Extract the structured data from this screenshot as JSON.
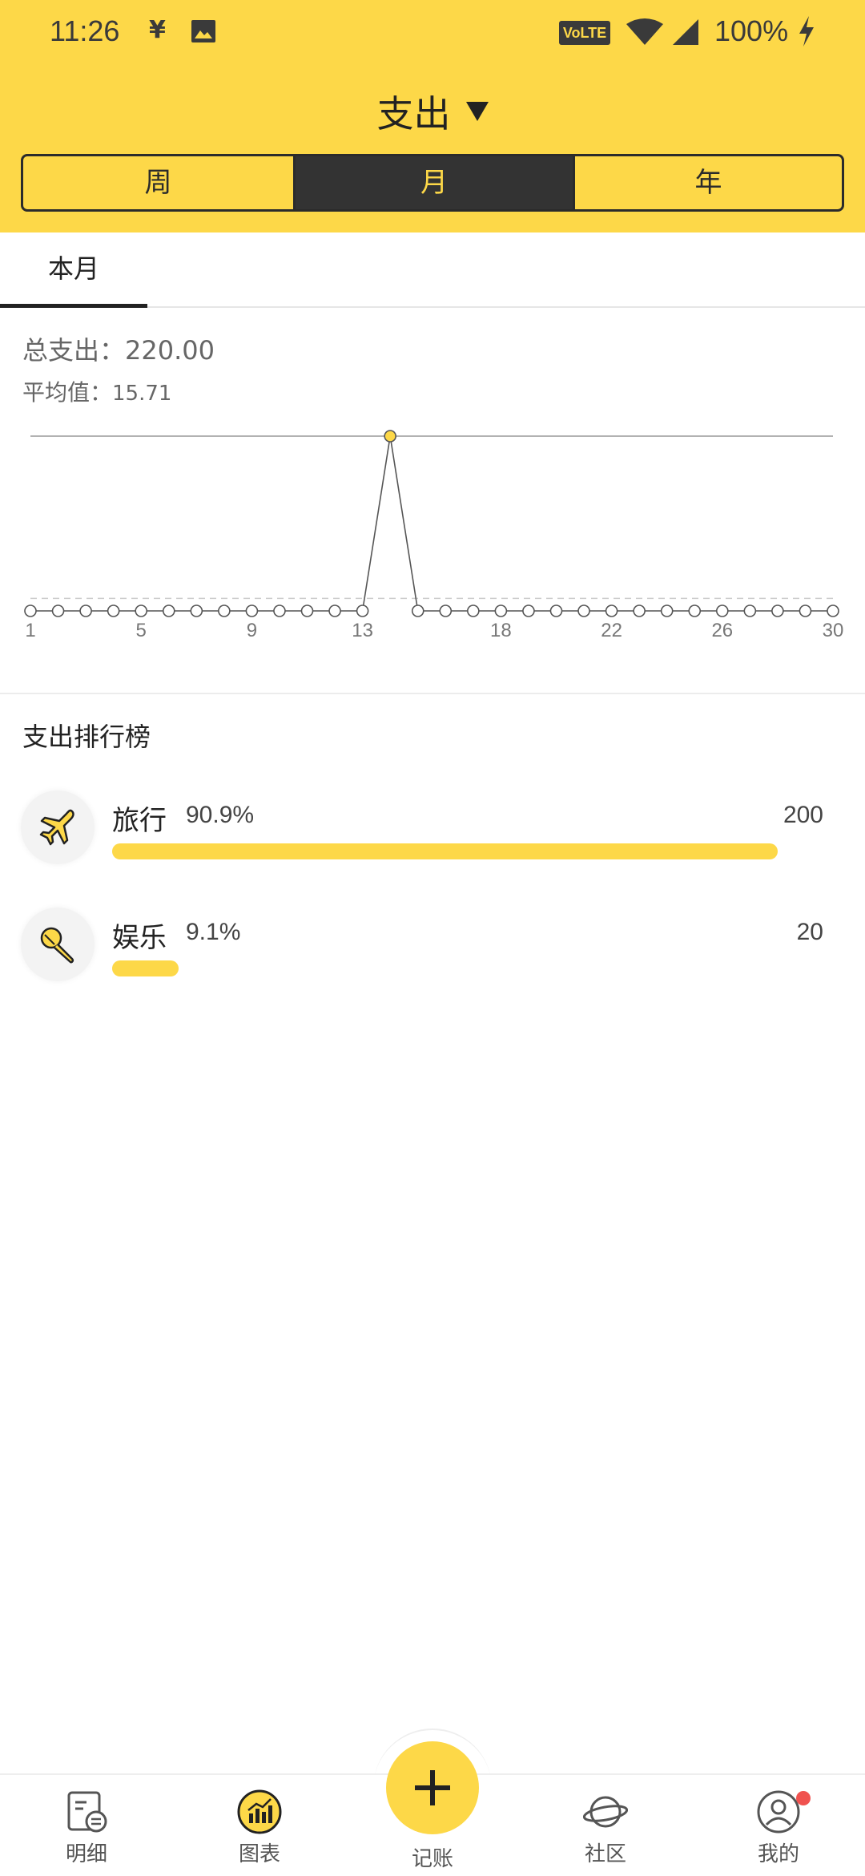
{
  "status_bar": {
    "time": "11:26",
    "yen_symbol": "¥",
    "volte": "VoLTE",
    "battery": "100%"
  },
  "header": {
    "title": "支出",
    "segments": [
      "周",
      "月",
      "年"
    ],
    "selected_segment": "月"
  },
  "period_tab": "本月",
  "summary": {
    "total_label": "总支出：220.00",
    "avg_label": "平均值：",
    "avg_value": "15.71"
  },
  "chart_data": {
    "type": "line",
    "x": [
      1,
      2,
      3,
      4,
      5,
      6,
      7,
      8,
      9,
      10,
      11,
      12,
      13,
      14,
      15,
      16,
      17,
      18,
      19,
      20,
      21,
      22,
      23,
      24,
      25,
      26,
      27,
      28,
      29,
      30
    ],
    "values": [
      0,
      0,
      0,
      0,
      0,
      0,
      0,
      0,
      0,
      0,
      0,
      0,
      0,
      220,
      0,
      0,
      0,
      0,
      0,
      0,
      0,
      0,
      0,
      0,
      0,
      0,
      0,
      0,
      0,
      0
    ],
    "tick_labels": [
      "1",
      "5",
      "9",
      "13",
      "18",
      "22",
      "26",
      "30"
    ],
    "tick_days": [
      1,
      5,
      9,
      13,
      18,
      22,
      26,
      30
    ],
    "highlight_day": 14,
    "max_line_value": 220,
    "avg_line_value": 15.71,
    "grid": false,
    "colors": {
      "line": "#555555",
      "point_fill": "#ffffff",
      "highlight_fill": "#fdd848"
    }
  },
  "ranking": {
    "title": "支出排行榜",
    "items": [
      {
        "name": "旅行",
        "percent": "90.9%",
        "value": "200",
        "fraction": 0.909,
        "icon": "airplane-icon"
      },
      {
        "name": "娱乐",
        "percent": "9.1%",
        "value": "20",
        "fraction": 0.091,
        "icon": "microphone-icon"
      }
    ]
  },
  "bottom_nav": {
    "items": [
      "明细",
      "图表",
      "记账",
      "社区",
      "我的"
    ],
    "active": "图表"
  },
  "colors": {
    "accent": "#fdd848",
    "dark": "#333333",
    "badge": "#f0524f"
  }
}
